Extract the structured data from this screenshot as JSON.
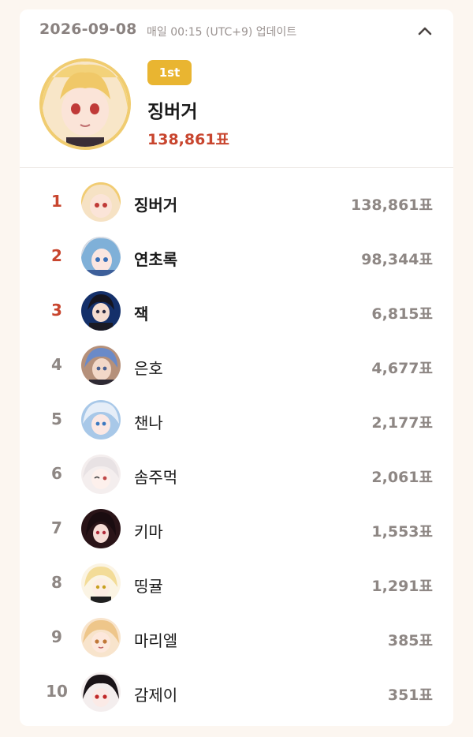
{
  "header": {
    "date": "2026-09-08",
    "update_note": "매일 00:15 (UTC+9) 업데이트",
    "collapse_icon": "chevron-up-icon"
  },
  "top": {
    "badge": "1st",
    "name": "징버거",
    "votes": "138,861표"
  },
  "colors": {
    "accent_red": "#c8452e",
    "badge_gold": "#e9b531",
    "muted": "#8e8784",
    "background": "#fcf6f0"
  },
  "ranking": [
    {
      "rank": "1",
      "name": "징버거",
      "votes": "138,861표"
    },
    {
      "rank": "2",
      "name": "연초록",
      "votes": "98,344표"
    },
    {
      "rank": "3",
      "name": "잭",
      "votes": "6,815표"
    },
    {
      "rank": "4",
      "name": "은호",
      "votes": "4,677표"
    },
    {
      "rank": "5",
      "name": "챈나",
      "votes": "2,177표"
    },
    {
      "rank": "6",
      "name": "솜주먹",
      "votes": "2,061표"
    },
    {
      "rank": "7",
      "name": "키마",
      "votes": "1,553표"
    },
    {
      "rank": "8",
      "name": "띵귤",
      "votes": "1,291표"
    },
    {
      "rank": "9",
      "name": "마리엘",
      "votes": "385표"
    },
    {
      "rank": "10",
      "name": "감제이",
      "votes": "351표"
    }
  ]
}
